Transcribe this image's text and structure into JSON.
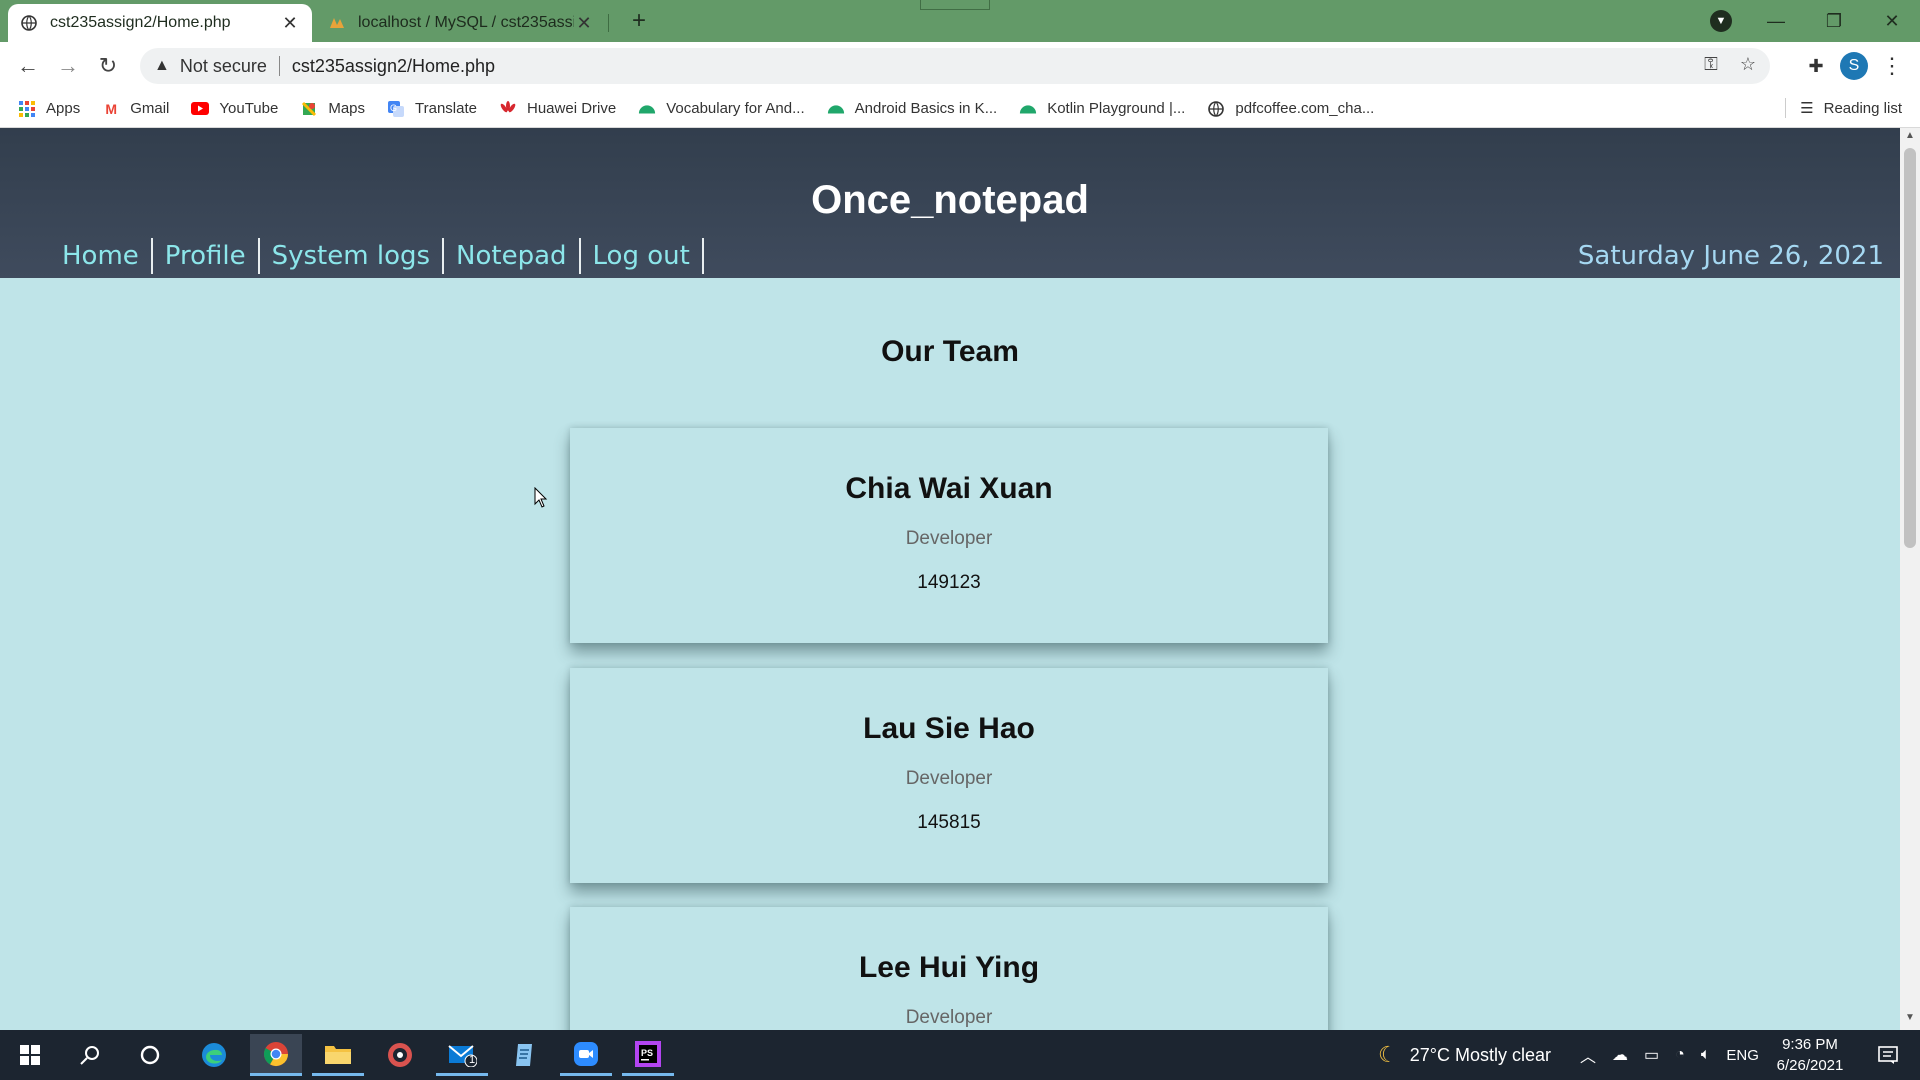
{
  "browser": {
    "tabs": [
      {
        "title": "cst235assign2/Home.php",
        "active": true
      },
      {
        "title": "localhost / MySQL / cst235assig",
        "active": false
      }
    ],
    "address": {
      "security_label": "Not secure",
      "url": "cst235assign2/Home.php"
    },
    "bookmarks": [
      {
        "label": "Apps",
        "icon": "apps-grid-icon"
      },
      {
        "label": "Gmail",
        "icon": "gmail-icon"
      },
      {
        "label": "YouTube",
        "icon": "youtube-icon"
      },
      {
        "label": "Maps",
        "icon": "maps-icon"
      },
      {
        "label": "Translate",
        "icon": "translate-icon"
      },
      {
        "label": "Huawei Drive",
        "icon": "huawei-icon"
      },
      {
        "label": "Vocabulary for And...",
        "icon": "android-icon"
      },
      {
        "label": "Android Basics in K...",
        "icon": "android-icon"
      },
      {
        "label": "Kotlin Playground |...",
        "icon": "android-icon"
      },
      {
        "label": "pdfcoffee.com_cha...",
        "icon": "globe-icon"
      }
    ],
    "reading_list": "Reading list",
    "profile_initial": "S"
  },
  "site": {
    "title": "Once_notepad",
    "nav": [
      "Home",
      "Profile",
      "System logs",
      "Notepad",
      "Log out"
    ],
    "date": "Saturday June 26, 2021"
  },
  "team": {
    "heading": "Our Team",
    "members": [
      {
        "name": "Chia Wai Xuan",
        "role": "Developer",
        "id": "149123"
      },
      {
        "name": "Lau Sie Hao",
        "role": "Developer",
        "id": "145815"
      },
      {
        "name": "Lee Hui Ying",
        "role": "Developer",
        "id": ""
      }
    ]
  },
  "taskbar": {
    "weather": "27°C  Mostly clear",
    "language": "ENG",
    "time": "9:36 PM",
    "date": "6/26/2021",
    "mail_badge": "1"
  },
  "colors": {
    "page_bg": "#bfe4e8",
    "header_bg": "#323e4d",
    "nav_link": "#8ce6ea",
    "date_text": "#a5d8f2",
    "tabstrip": "#639a68"
  }
}
